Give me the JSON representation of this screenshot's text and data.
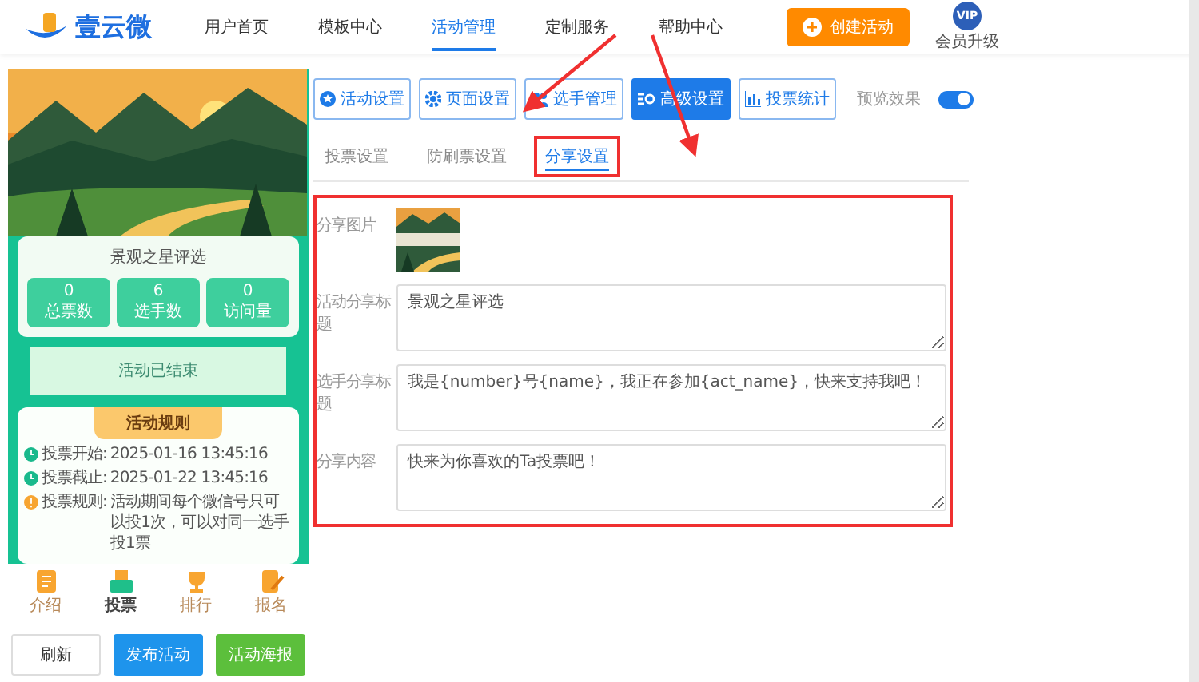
{
  "header": {
    "logo_text": "壹云微",
    "nav": [
      {
        "label": "用户首页",
        "selected": false
      },
      {
        "label": "模板中心",
        "selected": false
      },
      {
        "label": "活动管理",
        "selected": true
      },
      {
        "label": "定制服务",
        "selected": false
      },
      {
        "label": "帮助中心",
        "selected": false
      }
    ],
    "create_button": "创建活动",
    "vip_badge": "VIP",
    "vip_label": "会员升级"
  },
  "preview": {
    "title": "景观之星评选",
    "stats": [
      {
        "value": "0",
        "label": "总票数"
      },
      {
        "value": "6",
        "label": "选手数"
      },
      {
        "value": "0",
        "label": "访问量"
      }
    ],
    "status": "活动已结束",
    "rules_title": "活动规则",
    "rules": [
      {
        "kind": "time",
        "label": "投票开始:",
        "value": "2025-01-16 13:45:16"
      },
      {
        "kind": "time",
        "label": "投票截止:",
        "value": "2025-01-22 13:45:16"
      },
      {
        "kind": "info",
        "label": "投票规则:",
        "value": "活动期间每个微信号只可以投1次，可以对同一选手投1票"
      }
    ],
    "tabs": [
      {
        "label": "介绍",
        "kind": "doc",
        "selected": false
      },
      {
        "label": "投票",
        "kind": "vote",
        "selected": true
      },
      {
        "label": "排行",
        "kind": "trophy",
        "selected": false
      },
      {
        "label": "报名",
        "kind": "signup",
        "selected": false
      }
    ]
  },
  "actions": [
    {
      "label": "刷新",
      "kind": "plain"
    },
    {
      "label": "发布活动",
      "kind": "primary"
    },
    {
      "label": "活动海报",
      "kind": "success"
    }
  ],
  "toolbar": {
    "buttons": [
      {
        "label": "活动设置",
        "kind": "star",
        "selected": false
      },
      {
        "label": "页面设置",
        "kind": "gear",
        "selected": false
      },
      {
        "label": "选手管理",
        "kind": "people",
        "selected": false
      },
      {
        "label": "高级设置",
        "kind": "sliders",
        "selected": true
      },
      {
        "label": "投票统计",
        "kind": "chart",
        "selected": false
      }
    ],
    "preview_label": "预览效果",
    "preview_on": true
  },
  "subtabs": [
    {
      "label": "投票设置",
      "selected": false,
      "highlighted": false
    },
    {
      "label": "防刷票设置",
      "selected": false,
      "highlighted": false
    },
    {
      "label": "分享设置",
      "selected": true,
      "highlighted": true
    }
  ],
  "form": {
    "highlighted": true,
    "fields": [
      {
        "label": "分享图片"
      },
      {
        "kind": "text",
        "label": "活动分享标题",
        "value": "景观之星评选"
      },
      {
        "kind": "text",
        "label": "选手分享标题",
        "value": "我是{number}号{name}，我正在参加{act_name}，快来支持我吧！"
      },
      {
        "kind": "text",
        "label": "分享内容",
        "value": "快来为你喜欢的Ta投票吧！"
      }
    ]
  }
}
